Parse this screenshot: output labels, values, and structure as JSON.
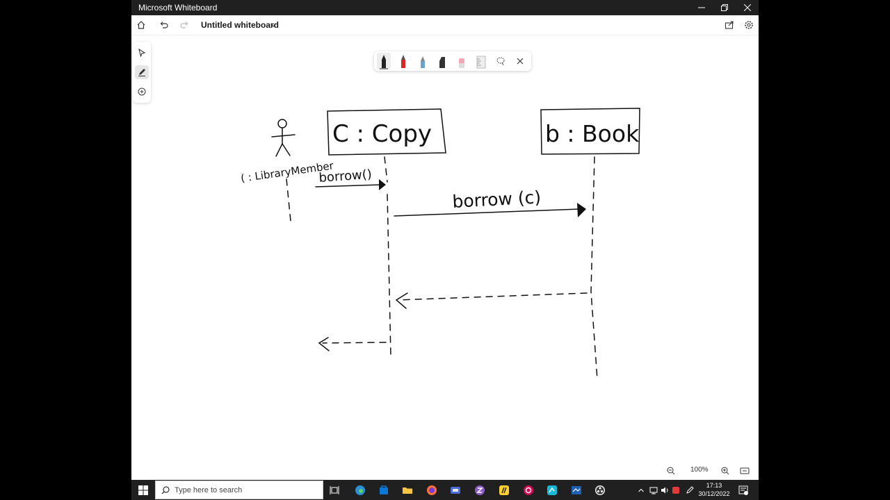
{
  "window": {
    "title": "Microsoft Whiteboard"
  },
  "appbar": {
    "board_title": "Untitled whiteboard"
  },
  "diagram": {
    "object_copy": "C : Copy",
    "object_book": "b : Book",
    "actor_label": "( : LibraryMember",
    "message_borrow": "borrow()",
    "message_borrow_c": "borrow (c)"
  },
  "zoom": {
    "level": "100%"
  },
  "taskbar": {
    "search_placeholder": "Type here to search"
  },
  "clock": {
    "time": "17:13",
    "date": "30/12/2022"
  },
  "colors": {
    "ink": "#111111",
    "pen_red": "#d62828",
    "pen_blue": "#6aa4c8",
    "titlebar": "#202020"
  }
}
